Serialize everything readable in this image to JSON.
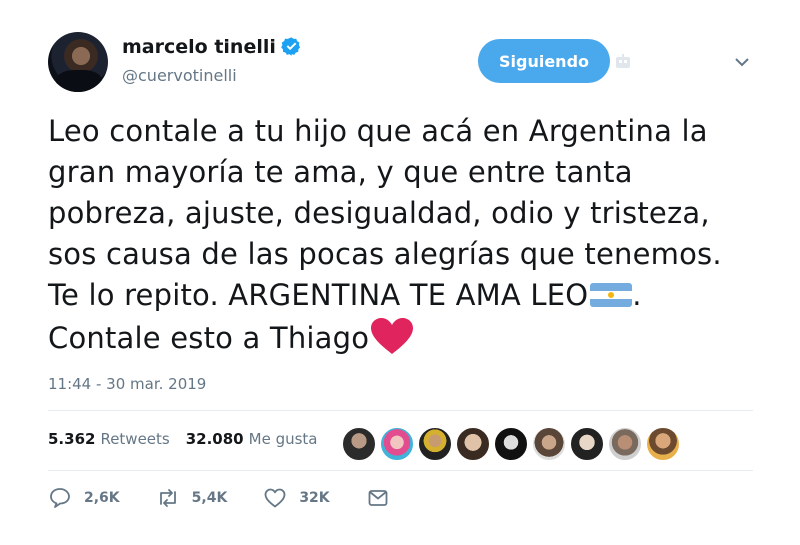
{
  "user": {
    "name": "marcelo tinelli",
    "handle": "@cuervotinelli",
    "follow_label": "Siguiendo"
  },
  "tweet": {
    "lines": [
      "Leo contale a tu hijo que acá en Argentina  la",
      "gran mayoría te ama, y que entre tanta",
      "pobreza, ajuste, desigualdad, odio y tristeza,",
      "sos causa de las pocas alegrías que tenemos.",
      "Te lo repito. ARGENTINA TE AMA LEO",
      ".",
      "Contale esto a Thiago"
    ],
    "timestamp": "11:44 - 30 mar. 2019"
  },
  "stats": {
    "retweets_count": "5.362",
    "retweets_label": "Retweets",
    "likes_count": "32.080",
    "likes_label": "Me gusta"
  },
  "actions": {
    "replies": "2,6K",
    "retweets": "5,4K",
    "likes": "32K"
  },
  "colors": {
    "accent": "#4aa8ec",
    "verified": "#1da1f2",
    "muted": "#657786",
    "heart": "#e0245e",
    "flag_blue": "#74acdf"
  },
  "icons": [
    "verified-badge-icon",
    "bot-icon",
    "chevron-down-icon",
    "argentina-flag-icon",
    "red-heart-icon",
    "reply-icon",
    "retweet-icon",
    "like-icon",
    "message-icon"
  ]
}
